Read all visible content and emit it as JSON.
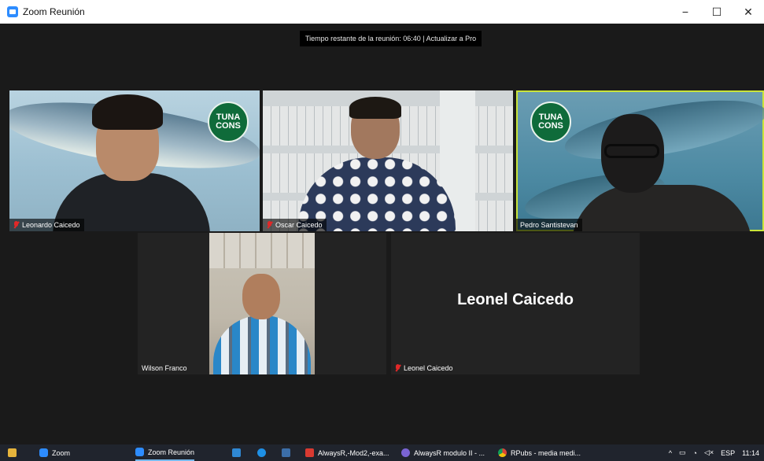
{
  "window": {
    "title": "Zoom Reunión",
    "controls": {
      "minimize": "−",
      "maximize": "☐",
      "close": "✕"
    }
  },
  "meeting": {
    "banner": "Tiempo restante de la reunión: 06:40 | Actualizar a Pro",
    "participants": [
      {
        "name": "Leonardo Caicedo",
        "muted": true,
        "video": true
      },
      {
        "name": "Oscar Caicedo",
        "muted": true,
        "video": true
      },
      {
        "name": "Pedro Santistevan",
        "muted": false,
        "video": true,
        "active_speaker": true
      },
      {
        "name": "Wilson Franco",
        "muted": false,
        "video": true
      },
      {
        "name": "Leonel Caicedo",
        "muted": true,
        "video": false,
        "display_name": "Leonel Caicedo"
      }
    ],
    "logo": {
      "line1": "TUNA",
      "line2": "CONS"
    },
    "accent_colors": {
      "active_speaker_border": "#c9e43a",
      "muted_icon": "#e02828",
      "zoom_blue": "#2d8cff"
    }
  },
  "taskbar": {
    "items": [
      {
        "label": "",
        "icon": "folder-icon"
      },
      {
        "label": "Zoom",
        "icon": "zoom-icon"
      },
      {
        "label": "Zoom Reunión",
        "icon": "zoom-icon",
        "active": true
      },
      {
        "label": "",
        "icon": "mail-icon"
      },
      {
        "label": "",
        "icon": "edge-icon"
      },
      {
        "label": "",
        "icon": "store-icon"
      },
      {
        "label": "AlwaysR,-Mod2,-exa...",
        "icon": "pdf-icon"
      },
      {
        "label": "AlwaysR modulo II - ...",
        "icon": "browser-icon"
      },
      {
        "label": "RPubs - media medi...",
        "icon": "chrome-icon"
      }
    ],
    "tray": {
      "chevron": "^",
      "lang": "ESP",
      "time": "11:14"
    }
  }
}
